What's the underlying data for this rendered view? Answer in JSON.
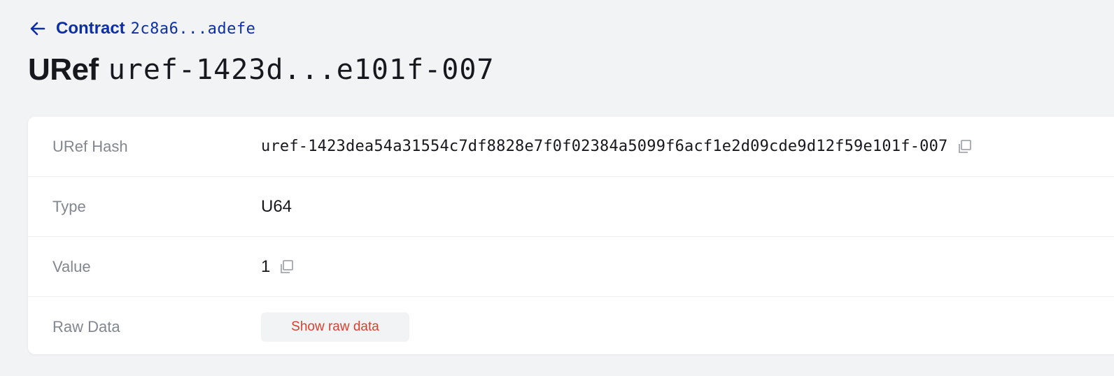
{
  "breadcrumb": {
    "back_icon": "arrow-left-icon",
    "label": "Contract",
    "hash": "2c8a6...adefe"
  },
  "title": {
    "label": "URef",
    "hash": "uref-1423d...e101f-007"
  },
  "details": {
    "uref_hash": {
      "label": "URef Hash",
      "value": "uref-1423dea54a31554c7df8828e7f0f02384a5099f6acf1e2d09cde9d12f59e101f-007",
      "icon": "copy-icon"
    },
    "type": {
      "label": "Type",
      "value": "U64"
    },
    "value": {
      "label": "Value",
      "value": "1",
      "icon": "copy-icon"
    },
    "raw_data": {
      "label": "Raw Data",
      "button_label": "Show raw data"
    }
  },
  "colors": {
    "background": "#f2f3f5",
    "link_blue": "#0d2fa3",
    "label_gray": "#82868f",
    "text_dark": "#16181d",
    "button_red": "#d8402e"
  }
}
